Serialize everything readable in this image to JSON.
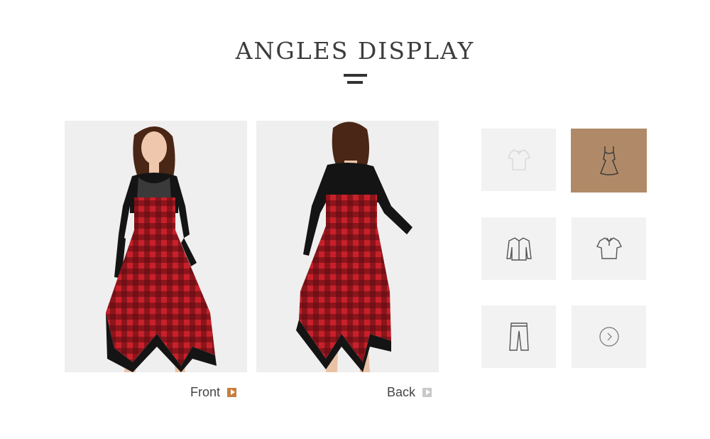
{
  "page": {
    "title": "ANGLES DISPLAY"
  },
  "views": [
    {
      "label": "Front",
      "active": true
    },
    {
      "label": "Back",
      "active": false
    }
  ],
  "thumbnails": [
    {
      "icon": "tshirt-icon",
      "active": false
    },
    {
      "icon": "dress-icon",
      "active": true
    },
    {
      "icon": "shirt-icon",
      "active": false
    },
    {
      "icon": "polo-shirt-icon",
      "active": false
    },
    {
      "icon": "pants-icon",
      "active": false
    },
    {
      "icon": "chevron-right-icon",
      "active": false
    }
  ],
  "colors": {
    "accent": "#c97e3f",
    "active_thumb": "#b08a68",
    "plaid_red": "#c8202a",
    "lace_black": "#141414"
  }
}
